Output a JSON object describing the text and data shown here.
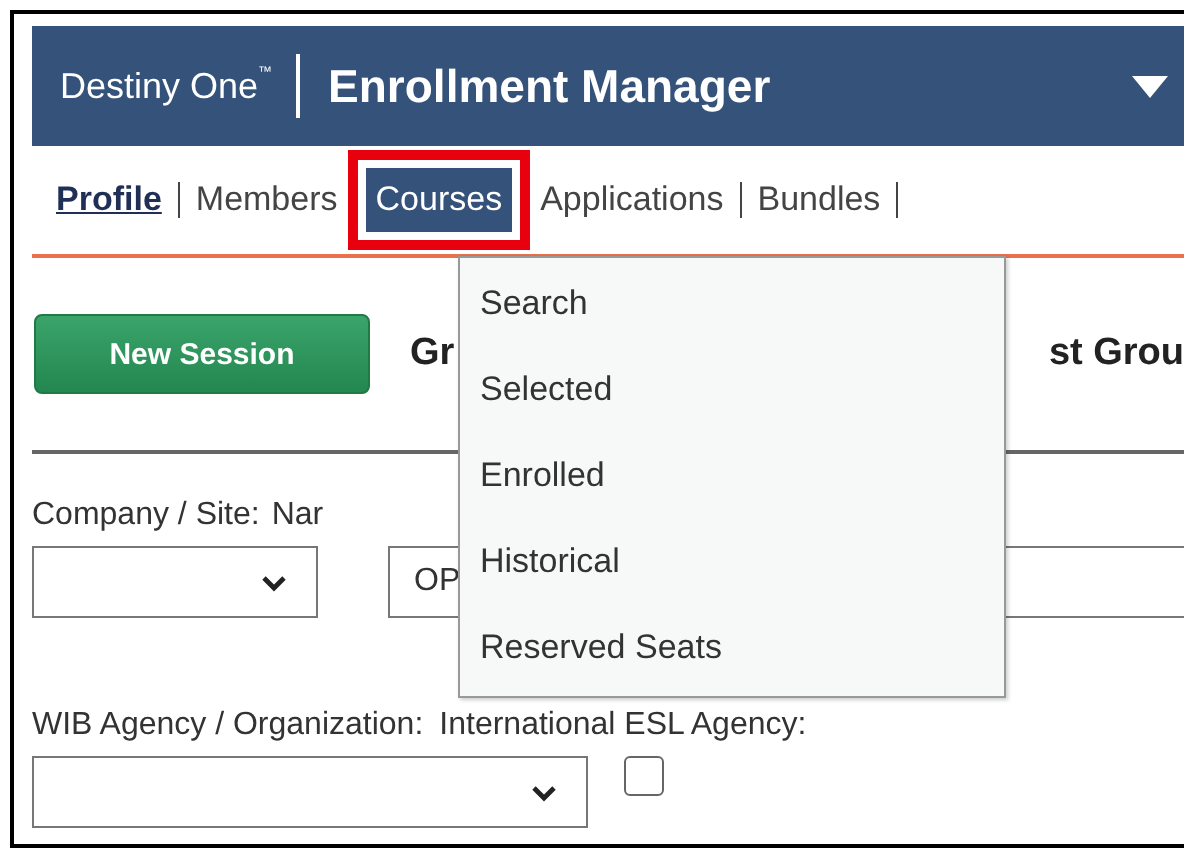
{
  "header": {
    "brand": "Destiny One",
    "trademark": "™",
    "title": "Enrollment Manager"
  },
  "nav": [
    {
      "label": "Profile",
      "selected": true
    },
    {
      "label": "Members",
      "selected": false
    },
    {
      "label": "Courses",
      "selected": false,
      "highlighted": true
    },
    {
      "label": "Applications",
      "selected": false
    },
    {
      "label": "Bundles",
      "selected": false
    }
  ],
  "menu": [
    "Search",
    "Selected",
    "Enrolled",
    "Historical",
    "Reserved Seats"
  ],
  "new_session_button": "New Session",
  "heading_fragments": [
    "Gr",
    "st Grou"
  ],
  "form": {
    "company_label": "Company / Site:",
    "name_label_fragment": "Nar",
    "name_value_fragment": "OP",
    "wib_label": "WIB Agency / Organization:",
    "esl_label": "International ESL Agency:",
    "esl_checked": false
  }
}
